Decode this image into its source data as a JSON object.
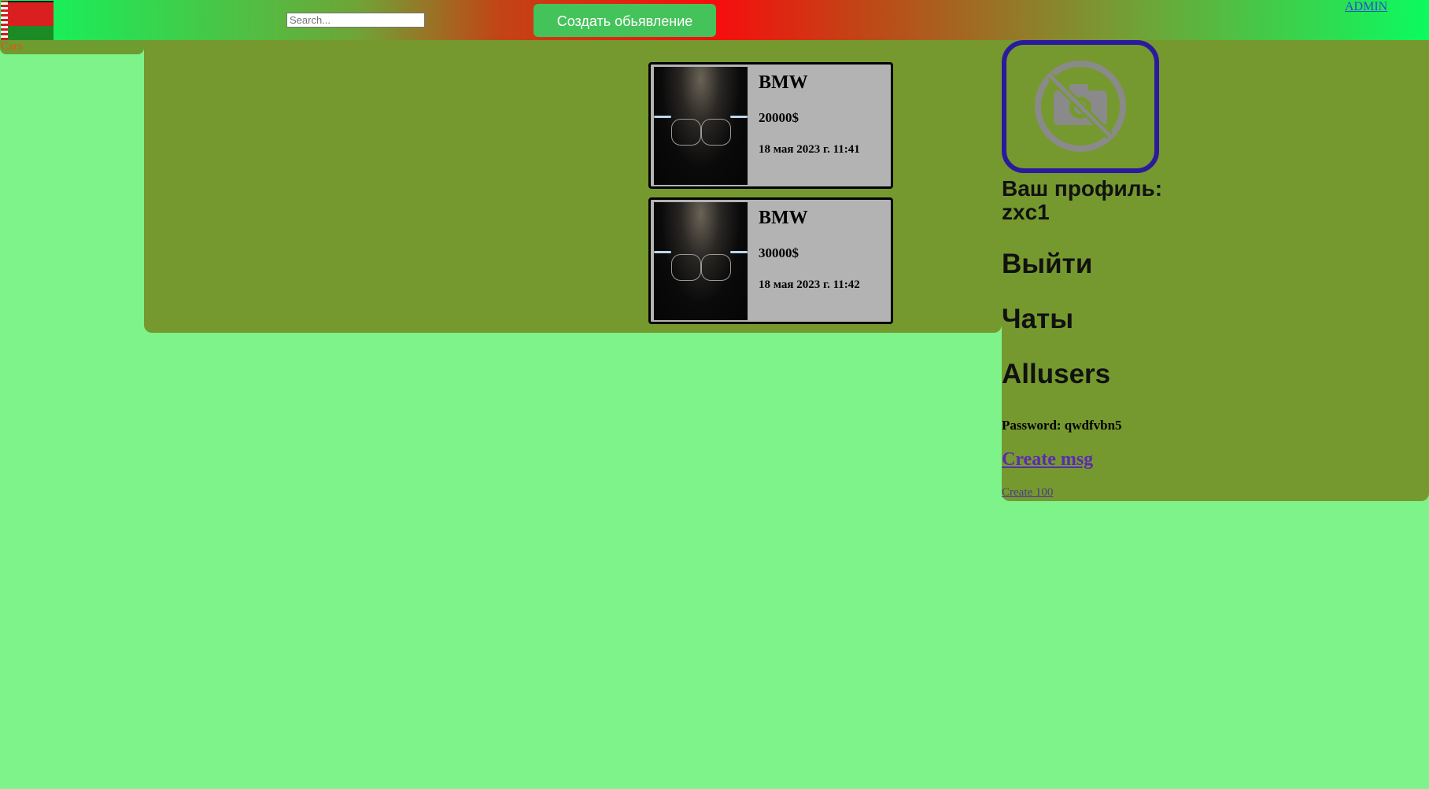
{
  "header": {
    "search_placeholder": "Search...",
    "create_ad_label": "Создать обьявление",
    "admin_label": "ADMIN"
  },
  "sidebar": {
    "category_label": "Cars",
    "count": "2"
  },
  "listings": [
    {
      "title": "BMW",
      "price": "20000$",
      "date": "18 мая 2023 г. 11:41"
    },
    {
      "title": "BMW",
      "price": "30000$",
      "date": "18 мая 2023 г. 11:42"
    }
  ],
  "profile": {
    "title": "Ваш профиль:",
    "username": "zxc1",
    "logout_label": "Выйти",
    "chats_label": "Чаты",
    "allusers_label": "Allusers",
    "password_text": "Password: qwdfvbn5",
    "create_msg_label": "Create msg",
    "create_100_label": "Create 100"
  },
  "colors": {
    "page_bg": "#7df38a",
    "panel_bg": "#75992e",
    "card_bg": "#b3b3b3",
    "create_button_bg": "#45c35b",
    "avatar_border": "#2a1a9e"
  }
}
